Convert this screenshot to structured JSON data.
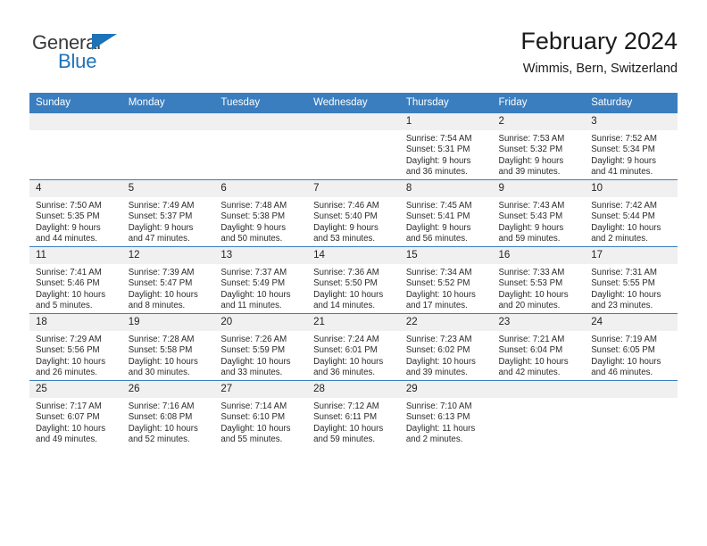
{
  "brand": {
    "name_part1": "General",
    "name_part2": "Blue",
    "accent_color": "#1e72b8"
  },
  "header": {
    "title": "February 2024",
    "subtitle": "Wimmis, Bern, Switzerland"
  },
  "theme": {
    "header_blue": "#3a7ebf",
    "daynum_bg": "#f0f0f0"
  },
  "weekdays": [
    "Sunday",
    "Monday",
    "Tuesday",
    "Wednesday",
    "Thursday",
    "Friday",
    "Saturday"
  ],
  "weeks": [
    [
      {
        "day": "",
        "lines": []
      },
      {
        "day": "",
        "lines": []
      },
      {
        "day": "",
        "lines": []
      },
      {
        "day": "",
        "lines": []
      },
      {
        "day": "1",
        "lines": [
          "Sunrise: 7:54 AM",
          "Sunset: 5:31 PM",
          "Daylight: 9 hours",
          "and 36 minutes."
        ]
      },
      {
        "day": "2",
        "lines": [
          "Sunrise: 7:53 AM",
          "Sunset: 5:32 PM",
          "Daylight: 9 hours",
          "and 39 minutes."
        ]
      },
      {
        "day": "3",
        "lines": [
          "Sunrise: 7:52 AM",
          "Sunset: 5:34 PM",
          "Daylight: 9 hours",
          "and 41 minutes."
        ]
      }
    ],
    [
      {
        "day": "4",
        "lines": [
          "Sunrise: 7:50 AM",
          "Sunset: 5:35 PM",
          "Daylight: 9 hours",
          "and 44 minutes."
        ]
      },
      {
        "day": "5",
        "lines": [
          "Sunrise: 7:49 AM",
          "Sunset: 5:37 PM",
          "Daylight: 9 hours",
          "and 47 minutes."
        ]
      },
      {
        "day": "6",
        "lines": [
          "Sunrise: 7:48 AM",
          "Sunset: 5:38 PM",
          "Daylight: 9 hours",
          "and 50 minutes."
        ]
      },
      {
        "day": "7",
        "lines": [
          "Sunrise: 7:46 AM",
          "Sunset: 5:40 PM",
          "Daylight: 9 hours",
          "and 53 minutes."
        ]
      },
      {
        "day": "8",
        "lines": [
          "Sunrise: 7:45 AM",
          "Sunset: 5:41 PM",
          "Daylight: 9 hours",
          "and 56 minutes."
        ]
      },
      {
        "day": "9",
        "lines": [
          "Sunrise: 7:43 AM",
          "Sunset: 5:43 PM",
          "Daylight: 9 hours",
          "and 59 minutes."
        ]
      },
      {
        "day": "10",
        "lines": [
          "Sunrise: 7:42 AM",
          "Sunset: 5:44 PM",
          "Daylight: 10 hours",
          "and 2 minutes."
        ]
      }
    ],
    [
      {
        "day": "11",
        "lines": [
          "Sunrise: 7:41 AM",
          "Sunset: 5:46 PM",
          "Daylight: 10 hours",
          "and 5 minutes."
        ]
      },
      {
        "day": "12",
        "lines": [
          "Sunrise: 7:39 AM",
          "Sunset: 5:47 PM",
          "Daylight: 10 hours",
          "and 8 minutes."
        ]
      },
      {
        "day": "13",
        "lines": [
          "Sunrise: 7:37 AM",
          "Sunset: 5:49 PM",
          "Daylight: 10 hours",
          "and 11 minutes."
        ]
      },
      {
        "day": "14",
        "lines": [
          "Sunrise: 7:36 AM",
          "Sunset: 5:50 PM",
          "Daylight: 10 hours",
          "and 14 minutes."
        ]
      },
      {
        "day": "15",
        "lines": [
          "Sunrise: 7:34 AM",
          "Sunset: 5:52 PM",
          "Daylight: 10 hours",
          "and 17 minutes."
        ]
      },
      {
        "day": "16",
        "lines": [
          "Sunrise: 7:33 AM",
          "Sunset: 5:53 PM",
          "Daylight: 10 hours",
          "and 20 minutes."
        ]
      },
      {
        "day": "17",
        "lines": [
          "Sunrise: 7:31 AM",
          "Sunset: 5:55 PM",
          "Daylight: 10 hours",
          "and 23 minutes."
        ]
      }
    ],
    [
      {
        "day": "18",
        "lines": [
          "Sunrise: 7:29 AM",
          "Sunset: 5:56 PM",
          "Daylight: 10 hours",
          "and 26 minutes."
        ]
      },
      {
        "day": "19",
        "lines": [
          "Sunrise: 7:28 AM",
          "Sunset: 5:58 PM",
          "Daylight: 10 hours",
          "and 30 minutes."
        ]
      },
      {
        "day": "20",
        "lines": [
          "Sunrise: 7:26 AM",
          "Sunset: 5:59 PM",
          "Daylight: 10 hours",
          "and 33 minutes."
        ]
      },
      {
        "day": "21",
        "lines": [
          "Sunrise: 7:24 AM",
          "Sunset: 6:01 PM",
          "Daylight: 10 hours",
          "and 36 minutes."
        ]
      },
      {
        "day": "22",
        "lines": [
          "Sunrise: 7:23 AM",
          "Sunset: 6:02 PM",
          "Daylight: 10 hours",
          "and 39 minutes."
        ]
      },
      {
        "day": "23",
        "lines": [
          "Sunrise: 7:21 AM",
          "Sunset: 6:04 PM",
          "Daylight: 10 hours",
          "and 42 minutes."
        ]
      },
      {
        "day": "24",
        "lines": [
          "Sunrise: 7:19 AM",
          "Sunset: 6:05 PM",
          "Daylight: 10 hours",
          "and 46 minutes."
        ]
      }
    ],
    [
      {
        "day": "25",
        "lines": [
          "Sunrise: 7:17 AM",
          "Sunset: 6:07 PM",
          "Daylight: 10 hours",
          "and 49 minutes."
        ]
      },
      {
        "day": "26",
        "lines": [
          "Sunrise: 7:16 AM",
          "Sunset: 6:08 PM",
          "Daylight: 10 hours",
          "and 52 minutes."
        ]
      },
      {
        "day": "27",
        "lines": [
          "Sunrise: 7:14 AM",
          "Sunset: 6:10 PM",
          "Daylight: 10 hours",
          "and 55 minutes."
        ]
      },
      {
        "day": "28",
        "lines": [
          "Sunrise: 7:12 AM",
          "Sunset: 6:11 PM",
          "Daylight: 10 hours",
          "and 59 minutes."
        ]
      },
      {
        "day": "29",
        "lines": [
          "Sunrise: 7:10 AM",
          "Sunset: 6:13 PM",
          "Daylight: 11 hours",
          "and 2 minutes."
        ]
      },
      {
        "day": "",
        "lines": []
      },
      {
        "day": "",
        "lines": []
      }
    ]
  ]
}
